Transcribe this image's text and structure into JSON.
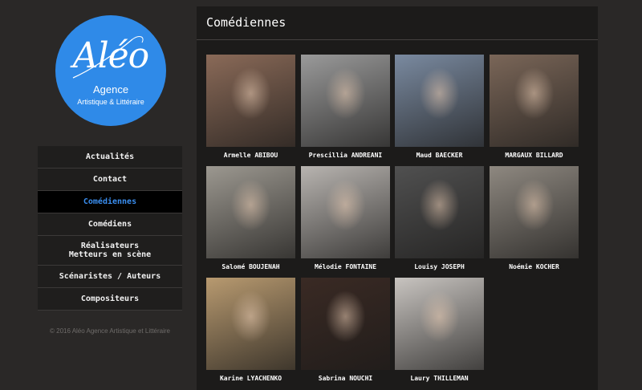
{
  "logo": {
    "script": "Aléo",
    "line1": "Agence",
    "line2": "Artistique & Littéraire",
    "color": "#2f8ae8"
  },
  "nav": {
    "items": [
      {
        "label": "Actualités"
      },
      {
        "label": "Contact"
      },
      {
        "label": "Comédiennes",
        "active": true
      },
      {
        "label": "Comédiens"
      },
      {
        "label": "Réalisateurs\nMetteurs en scène"
      },
      {
        "label": "Scénaristes / Auteurs"
      },
      {
        "label": "Compositeurs"
      }
    ],
    "active_color": "#3a8ef0"
  },
  "footer": {
    "copyright": "© 2016 Aléo Agence Artistique et Littéraire"
  },
  "main": {
    "title": "Comédiennes",
    "actresses": [
      {
        "name": "Armelle ABIBOU",
        "tone": "#8a6a58"
      },
      {
        "name": "Prescillia ANDREANI",
        "tone": "#9a9a9a"
      },
      {
        "name": "Maud BAECKER",
        "tone": "#7a8aa0"
      },
      {
        "name": "MARGAUX BILLARD",
        "tone": "#7a6658"
      },
      {
        "name": "Salomé BOUJENAH",
        "tone": "#9c9890"
      },
      {
        "name": "Mélodie FONTAINE",
        "tone": "#b8b4b0"
      },
      {
        "name": "Louisy JOSEPH",
        "tone": "#505050"
      },
      {
        "name": "Noémie KOCHER",
        "tone": "#8e8880"
      },
      {
        "name": "Karine LYACHENKO",
        "tone": "#b89a70"
      },
      {
        "name": "Sabrina NOUCHI",
        "tone": "#3a2a24"
      },
      {
        "name": "Laury THILLEMAN",
        "tone": "#c8c4c0"
      }
    ]
  }
}
